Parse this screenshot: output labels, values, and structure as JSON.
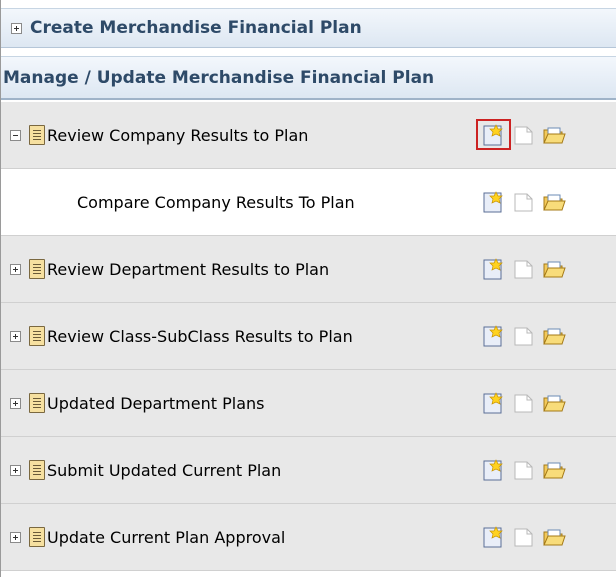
{
  "sections": {
    "create": {
      "label": "Create Merchandise Financial Plan",
      "expanded": false
    },
    "manage": {
      "label": "Manage / Update Merchandise Financial Plan"
    }
  },
  "rows": [
    {
      "label": "Review Company Results to Plan",
      "toggle": "minus",
      "shaded": true,
      "highlight_new": true
    },
    {
      "label": "Compare Company Results To Plan",
      "child": true,
      "shaded": false
    },
    {
      "label": "Review Department Results to Plan",
      "toggle": "plus",
      "shaded": true
    },
    {
      "label": "Review Class-SubClass Results to Plan",
      "toggle": "plus",
      "shaded": true
    },
    {
      "label": "Updated Department Plans",
      "toggle": "plus",
      "shaded": true
    },
    {
      "label": "Submit Updated Current Plan",
      "toggle": "plus",
      "shaded": true
    },
    {
      "label": "Update Current Plan Approval",
      "toggle": "plus",
      "shaded": true
    }
  ],
  "icons": {
    "new": "new-document-icon",
    "disabled": "blank-document-icon",
    "open": "open-folder-icon"
  },
  "colors": {
    "header_text": "#2e4a68",
    "row_shade": "#e8e8e8",
    "highlight": "#cc2222"
  }
}
